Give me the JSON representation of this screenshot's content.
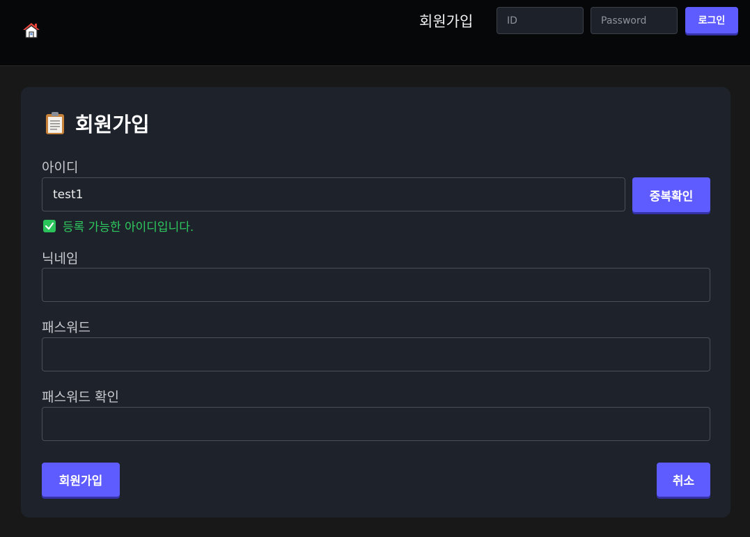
{
  "header": {
    "home_icon": "home-icon",
    "signup_link": "회원가입",
    "id_placeholder": "ID",
    "password_placeholder": "Password",
    "login_label": "로그인"
  },
  "form": {
    "title_icon": "clipboard-icon",
    "title": "회원가입",
    "id_label": "아이디",
    "id_value": "test1",
    "dup_check_label": "중복확인",
    "id_status": "등록 가능한 아이디입니다.",
    "nickname_label": "닉네임",
    "nickname_value": "",
    "password_label": "패스워드",
    "password_value": "",
    "password_confirm_label": "패스워드 확인",
    "password_confirm_value": "",
    "submit_label": "회원가입",
    "cancel_label": "취소"
  },
  "colors": {
    "accent": "#5f5cff",
    "success": "#2fcb5f",
    "card_bg": "#1d222b",
    "page_bg": "#181818",
    "header_bg": "#060708"
  }
}
